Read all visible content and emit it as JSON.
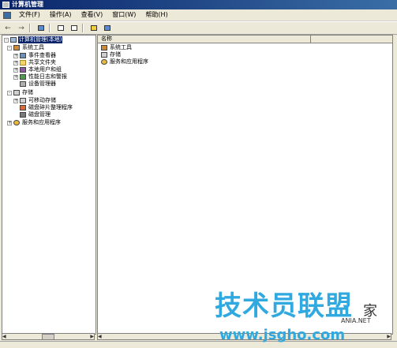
{
  "window": {
    "title": "计算机管理"
  },
  "menu": [
    "文件(F)",
    "操作(A)",
    "查看(V)",
    "窗口(W)",
    "帮助(H)"
  ],
  "toolbar": {
    "back": "←",
    "forward": "→"
  },
  "tree": [
    {
      "label": "计算机管理(本地)",
      "level": 0,
      "expander": "-",
      "icon": "computer-icon",
      "selected": true
    },
    {
      "label": "系统工具",
      "level": 1,
      "expander": "-",
      "icon": "tools-icon"
    },
    {
      "label": "事件查看器",
      "level": 2,
      "expander": "+",
      "icon": "event-viewer-icon"
    },
    {
      "label": "共享文件夹",
      "level": 2,
      "expander": "+",
      "icon": "shared-folder-icon"
    },
    {
      "label": "本地用户和组",
      "level": 2,
      "expander": "+",
      "icon": "users-icon"
    },
    {
      "label": "性能日志和警报",
      "level": 2,
      "expander": "+",
      "icon": "performance-icon"
    },
    {
      "label": "设备管理器",
      "level": 2,
      "expander": "",
      "icon": "device-manager-icon"
    },
    {
      "label": "存储",
      "level": 1,
      "expander": "-",
      "icon": "storage-icon"
    },
    {
      "label": "可移动存储",
      "level": 2,
      "expander": "+",
      "icon": "removable-storage-icon"
    },
    {
      "label": "磁盘碎片整理程序",
      "level": 2,
      "expander": "",
      "icon": "defrag-icon"
    },
    {
      "label": "磁盘管理",
      "level": 2,
      "expander": "",
      "icon": "disk-icon"
    },
    {
      "label": "服务和应用程序",
      "level": 1,
      "expander": "+",
      "icon": "services-icon"
    }
  ],
  "list": {
    "column": "名称",
    "items": [
      {
        "label": "系统工具",
        "icon": "tools-icon"
      },
      {
        "label": "存储",
        "icon": "storage-icon"
      },
      {
        "label": "服务和应用程序",
        "icon": "services-icon"
      }
    ]
  },
  "watermark": {
    "main": "技术员联盟",
    "jia": "家",
    "ania": "ANIA.NET",
    "url": "www.jsgho.com"
  }
}
